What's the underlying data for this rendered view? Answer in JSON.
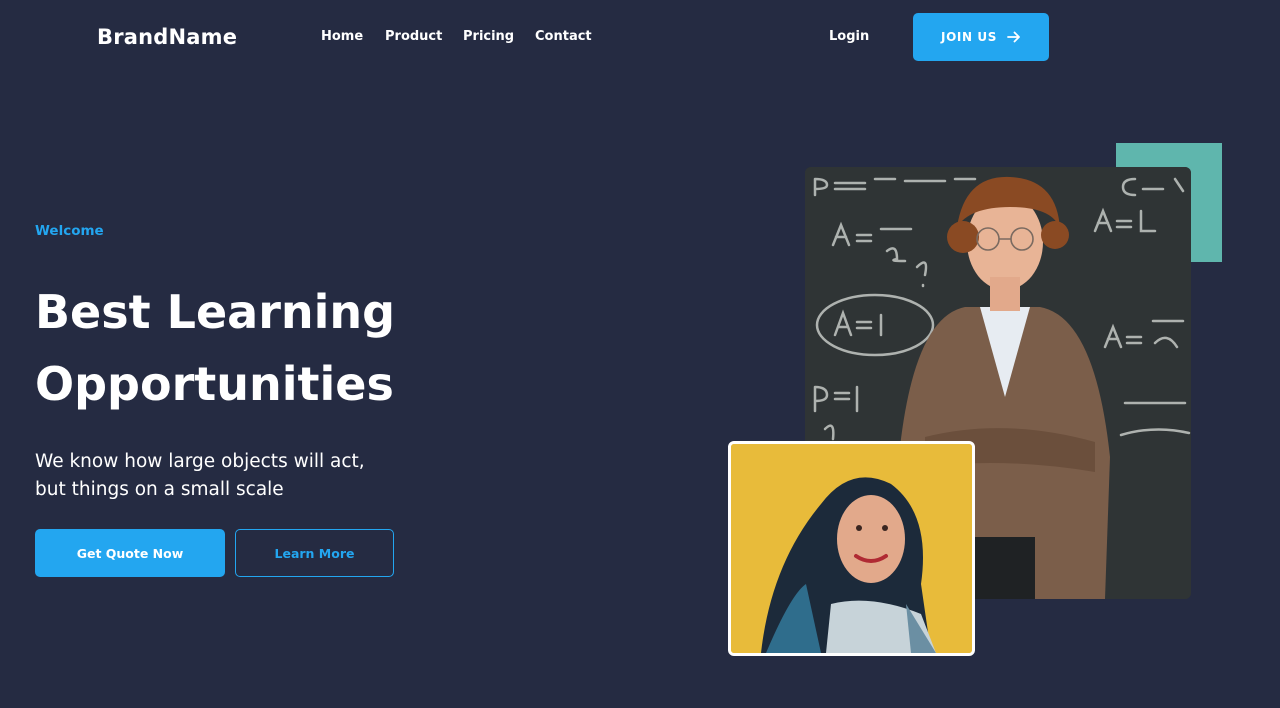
{
  "header": {
    "brand": "BrandName",
    "nav": [
      {
        "label": "Home"
      },
      {
        "label": "Product"
      },
      {
        "label": "Pricing"
      },
      {
        "label": "Contact"
      }
    ],
    "login_label": "Login",
    "join_label": "JOIN US",
    "join_icon": "arrow-right-icon"
  },
  "hero": {
    "eyebrow": "Welcome",
    "title_line1": "Best Learning",
    "title_line2": "Opportunities",
    "subtitle_line1": "We know how large objects will act,",
    "subtitle_line2": "but things on a small scale",
    "primary_cta": "Get Quote Now",
    "secondary_cta": "Learn More"
  },
  "colors": {
    "background": "#252b42",
    "accent": "#23a6f0",
    "teal_block": "#5fb6ad",
    "text": "#ffffff"
  }
}
